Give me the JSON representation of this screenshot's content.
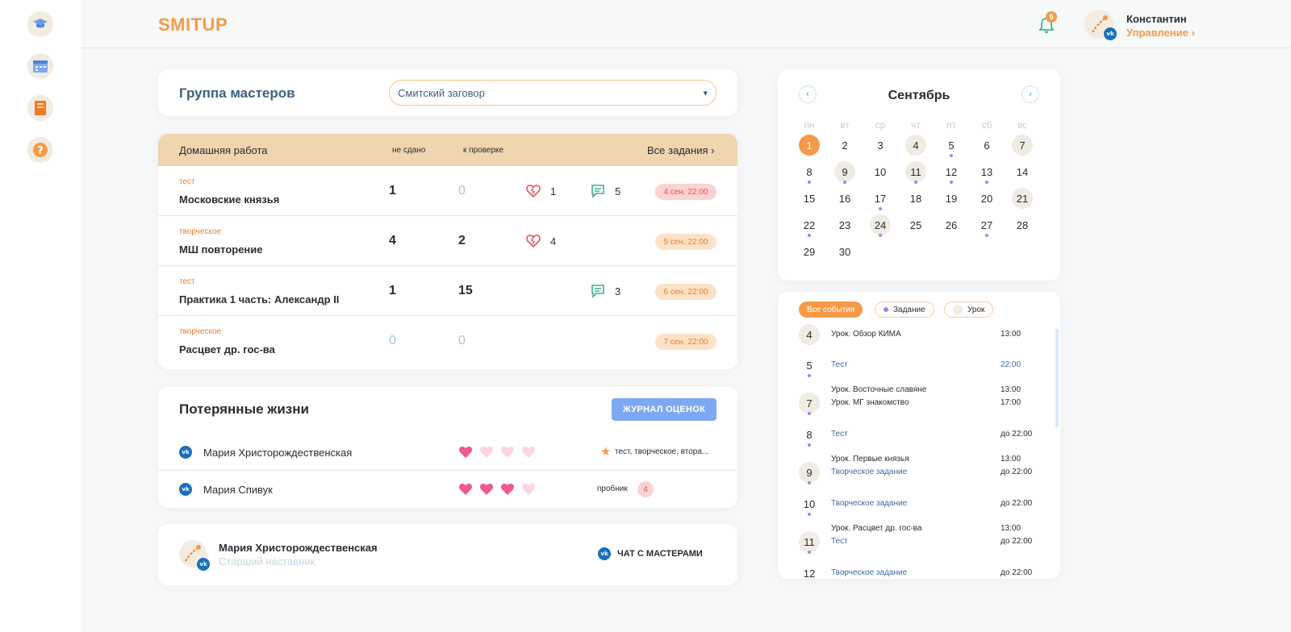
{
  "brand": {
    "logo_text": "SMITUP",
    "accent": "#f59a47"
  },
  "sidebar": {
    "icons": [
      "graduation-cap-icon",
      "calendar-icon",
      "book-icon",
      "help-icon"
    ]
  },
  "header": {
    "notifications_count": "5",
    "user_name": "Константин",
    "user_role": "Управление ›"
  },
  "group": {
    "title": "Группа мастеров",
    "selected": "Смитский заговор"
  },
  "homework": {
    "title": "Домашняя работа",
    "col_not_submitted": "не сдано",
    "col_to_check": "к проверке",
    "all_link": "Все задания ›",
    "rows": [
      {
        "kind": "тест",
        "name": "Московские князья",
        "not_submitted": "1",
        "to_check": "0",
        "lives": "1",
        "comments": "5",
        "deadline": "4 сен. 22:00",
        "deadline_style": "urgent"
      },
      {
        "kind": "творческое",
        "name": "МШ повторение",
        "not_submitted": "4",
        "to_check": "2",
        "lives": "4",
        "comments": "",
        "deadline": "5 сен. 22:00",
        "deadline_style": "normal"
      },
      {
        "kind": "тест",
        "name": "Практика 1 часть: Александр II",
        "not_submitted": "1",
        "to_check": "15",
        "lives": "",
        "comments": "3",
        "deadline": "6 сен. 22:00",
        "deadline_style": "normal"
      },
      {
        "kind": "творческое",
        "name": "Расцвет др. гос-ва",
        "not_submitted": "0",
        "to_check": "0",
        "lives": "",
        "comments": "",
        "deadline": "7 сен. 22:00",
        "deadline_style": "normal"
      }
    ]
  },
  "lives": {
    "title": "Потерянные жизни",
    "journal_button": "ЖУРНАЛ ОЦЕНОК",
    "rows": [
      {
        "name": "Мария Христорождественская",
        "hearts_full": 1,
        "hearts_total": 4,
        "note": "тест, творческое, втора..."
      },
      {
        "name": "Мария Спивук",
        "hearts_full": 3,
        "hearts_total": 4,
        "note": "пробник",
        "count": "4"
      }
    ]
  },
  "mentor": {
    "name": "Мария Христорождественская",
    "role": "Старший наставник",
    "chat_button": "ЧАТ С МАСТЕРАМИ"
  },
  "calendar": {
    "month": "Сентябрь",
    "weekdays": [
      "пн",
      "вт",
      "ср",
      "чт",
      "пт",
      "сб",
      "вс"
    ],
    "weeks": [
      [
        "1",
        "2",
        "3",
        "4",
        "5",
        "6",
        "7"
      ],
      [
        "8",
        "9",
        "10",
        "11",
        "12",
        "13",
        "14"
      ],
      [
        "15",
        "16",
        "17",
        "18",
        "19",
        "20",
        "21"
      ],
      [
        "22",
        "23",
        "24",
        "25",
        "26",
        "27",
        "28"
      ],
      [
        "29",
        "30",
        "",
        "",
        "",
        "",
        ""
      ]
    ],
    "today": "1",
    "highlighted": [
      "4",
      "7",
      "9",
      "11",
      "21",
      "24"
    ],
    "dotted": [
      "5",
      "8",
      "9",
      "11",
      "12",
      "13",
      "17",
      "22",
      "24",
      "27"
    ]
  },
  "events": {
    "filters": [
      {
        "label": "Все события",
        "active": true
      },
      {
        "label": "Задание",
        "active": false
      },
      {
        "label": "Урок",
        "active": false
      }
    ],
    "items": [
      {
        "day": "4",
        "hl": true,
        "lines": [
          {
            "text": "Урок. Обзор КИМА",
            "time": "13:00",
            "blue": false
          }
        ]
      },
      {
        "day": "5",
        "hl": false,
        "lines": [
          {
            "text": "Тест",
            "time": "22:00",
            "blue": true
          }
        ]
      },
      {
        "day": "7",
        "hl": true,
        "lines": [
          {
            "text": "Урок. Восточные славяне",
            "time": "13:00",
            "blue": false
          },
          {
            "text": "Урок. МГ знакомство",
            "time": "17:00",
            "blue": false
          }
        ]
      },
      {
        "day": "8",
        "hl": false,
        "lines": [
          {
            "text": "Тест",
            "time": "до 22:00",
            "blue": true
          }
        ]
      },
      {
        "day": "9",
        "hl": true,
        "lines": [
          {
            "text": "Урок. Первые князья",
            "time": "13:00",
            "blue": false
          },
          {
            "text": "Творческое задание",
            "time": "до 22:00",
            "blue": true
          }
        ]
      },
      {
        "day": "10",
        "hl": false,
        "lines": [
          {
            "text": "Творческое задание",
            "time": "до 22:00",
            "blue": true
          }
        ]
      },
      {
        "day": "11",
        "hl": true,
        "lines": [
          {
            "text": "Урок. Расцвет др. гос-ва",
            "time": "13:00",
            "blue": false
          },
          {
            "text": "Тест",
            "time": "до 22:00",
            "blue": true
          }
        ]
      },
      {
        "day": "12",
        "hl": false,
        "lines": [
          {
            "text": "Творческое задание",
            "time": "до 22:00",
            "blue": true
          }
        ]
      }
    ]
  }
}
